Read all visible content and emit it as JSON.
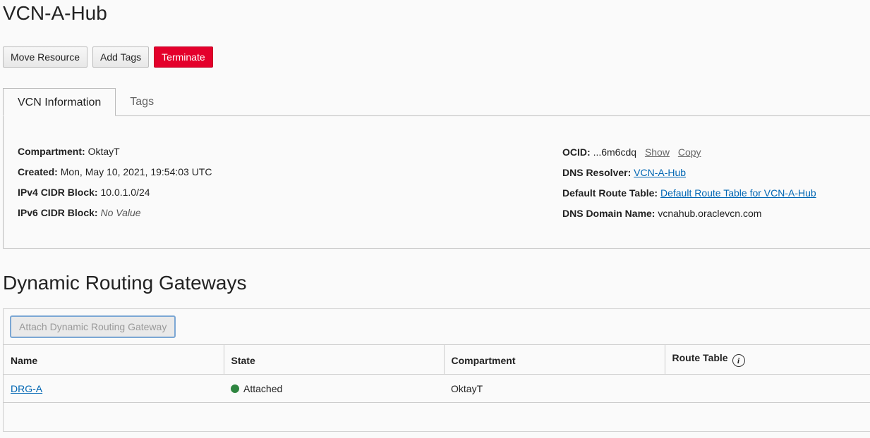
{
  "page": {
    "title": "VCN-A-Hub"
  },
  "actions": {
    "move_resource": "Move Resource",
    "add_tags": "Add Tags",
    "terminate": "Terminate"
  },
  "tabs": [
    {
      "label": "VCN Information",
      "active": true
    },
    {
      "label": "Tags",
      "active": false
    }
  ],
  "info": {
    "compartment": {
      "label": "Compartment:",
      "value": "OktayT"
    },
    "created": {
      "label": "Created:",
      "value": "Mon, May 10, 2021, 19:54:03 UTC"
    },
    "ipv4": {
      "label": "IPv4 CIDR Block:",
      "value": "10.0.1.0/24"
    },
    "ipv6": {
      "label": "IPv6 CIDR Block:",
      "value": "No Value"
    },
    "ocid": {
      "label": "OCID:",
      "value": "...6m6cdq",
      "show": "Show",
      "copy": "Copy"
    },
    "dns_resolver": {
      "label": "DNS Resolver:",
      "value": "VCN-A-Hub"
    },
    "route_table": {
      "label": "Default Route Table:",
      "value": "Default Route Table for VCN-A-Hub"
    },
    "dns_domain": {
      "label": "DNS Domain Name:",
      "value": "vcnahub.oraclevcn.com"
    }
  },
  "drg_section": {
    "title": "Dynamic Routing Gateways",
    "attach_button": "Attach Dynamic Routing Gateway",
    "columns": {
      "name": "Name",
      "state": "State",
      "compartment": "Compartment",
      "route_table": "Route Table"
    },
    "rows": [
      {
        "name": "DRG-A",
        "state": "Attached",
        "compartment": "OktayT",
        "route_table": ""
      }
    ],
    "status_color": "#2e8540"
  },
  "colors": {
    "danger": "#e4002b",
    "link": "#0066b3"
  }
}
